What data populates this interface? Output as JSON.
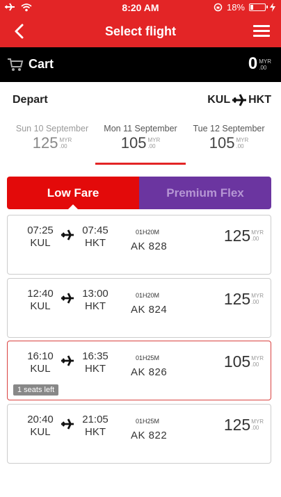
{
  "status_bar": {
    "time": "8:20 AM",
    "battery": "18%",
    "battery_level": 0.18
  },
  "nav": {
    "title": "Select flight"
  },
  "cart": {
    "label": "Cart",
    "amount": "0",
    "currency": "MYR",
    "decimals": ".00"
  },
  "route": {
    "depart_label": "Depart",
    "origin": "KUL",
    "destination": "HKT"
  },
  "dates": [
    {
      "label": "Sun 10 September",
      "amount": "125",
      "currency": "MYR",
      "decimals": ".00"
    },
    {
      "label": "Mon 11 September",
      "amount": "105",
      "currency": "MYR",
      "decimals": ".00"
    },
    {
      "label": "Tue 12 September",
      "amount": "105",
      "currency": "MYR",
      "decimals": ".00"
    }
  ],
  "tabs": {
    "low": "Low Fare",
    "premium": "Premium Flex"
  },
  "flights": [
    {
      "dep_time": "07:25",
      "arr_time": "07:45",
      "origin": "KUL",
      "destination": "HKT",
      "duration": "01H20M",
      "flight_no": "AK  828",
      "amount": "125",
      "currency": "MYR",
      "decimals": ".00"
    },
    {
      "dep_time": "12:40",
      "arr_time": "13:00",
      "origin": "KUL",
      "destination": "HKT",
      "duration": "01H20M",
      "flight_no": "AK  824",
      "amount": "125",
      "currency": "MYR",
      "decimals": ".00"
    },
    {
      "dep_time": "16:10",
      "arr_time": "16:35",
      "origin": "KUL",
      "destination": "HKT",
      "duration": "01H25M",
      "flight_no": "AK  826",
      "amount": "105",
      "currency": "MYR",
      "decimals": ".00",
      "seats_left": "1 seats left"
    },
    {
      "dep_time": "20:40",
      "arr_time": "21:05",
      "origin": "KUL",
      "destination": "HKT",
      "duration": "01H25M",
      "flight_no": "AK  822",
      "amount": "125",
      "currency": "MYR",
      "decimals": ".00"
    }
  ],
  "colors": {
    "brand_red": "#e32526",
    "premium_purple": "#6b35a0",
    "selected_border": "#d9413f"
  }
}
